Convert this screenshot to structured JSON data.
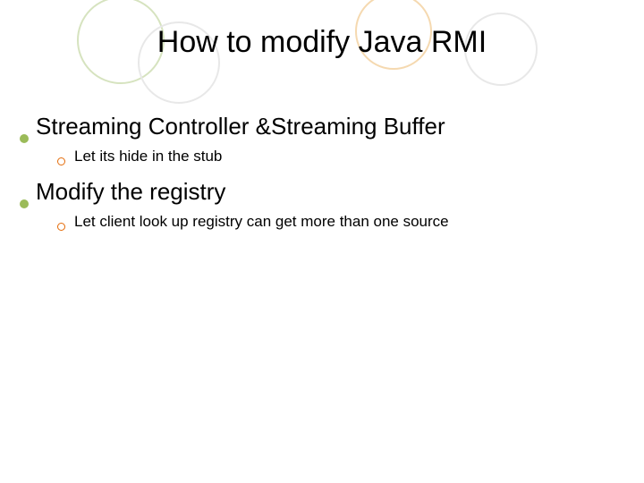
{
  "title": "How to modify Java RMI",
  "bullets": [
    {
      "text": "Streaming Controller &Streaming Buffer",
      "sub": [
        "Let its hide in the stub"
      ]
    },
    {
      "text": "Modify the registry",
      "sub": [
        "Let client look up registry can get more than one source"
      ]
    }
  ]
}
